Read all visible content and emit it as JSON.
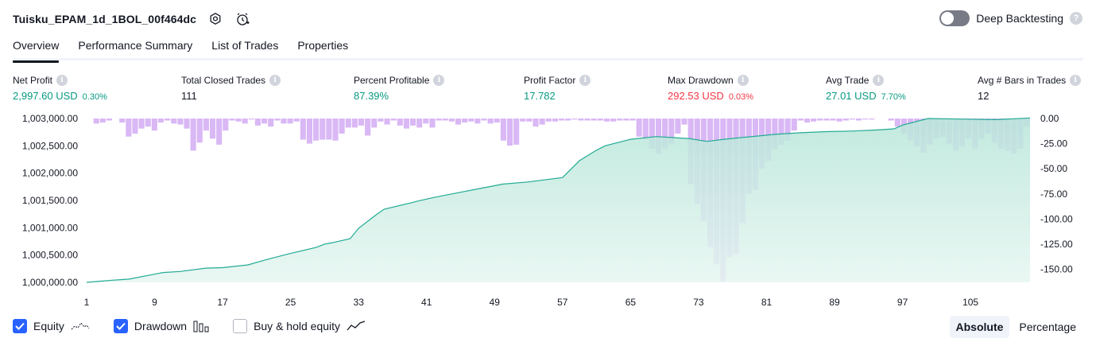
{
  "header": {
    "strategy_title": "Tuisku_EPAM_1d_1BOL_00f464dc",
    "deep_backtesting_label": "Deep Backtesting",
    "deep_backtesting_enabled": false
  },
  "tabs": [
    {
      "label": "Overview",
      "active": true
    },
    {
      "label": "Performance Summary",
      "active": false
    },
    {
      "label": "List of Trades",
      "active": false
    },
    {
      "label": "Properties",
      "active": false
    }
  ],
  "metrics": {
    "net_profit": {
      "label": "Net Profit",
      "value": "2,997.60 USD",
      "pct": "0.30%"
    },
    "total_closed_trades": {
      "label": "Total Closed Trades",
      "value": "111"
    },
    "percent_profitable": {
      "label": "Percent Profitable",
      "value": "87.39%"
    },
    "profit_factor": {
      "label": "Profit Factor",
      "value": "17.782"
    },
    "max_drawdown": {
      "label": "Max Drawdown",
      "value": "292.53 USD",
      "pct": "0.03%"
    },
    "avg_trade": {
      "label": "Avg Trade",
      "value": "27.01 USD",
      "pct": "7.70%"
    },
    "avg_bars": {
      "label": "Avg # Bars in Trades",
      "value": "12"
    }
  },
  "legend": {
    "equity_label": "Equity",
    "drawdown_label": "Drawdown",
    "buyhold_label": "Buy & hold equity",
    "equity_checked": true,
    "drawdown_checked": true,
    "buyhold_checked": false
  },
  "modes": {
    "absolute_label": "Absolute",
    "percentage_label": "Percentage",
    "active": "Absolute"
  },
  "colors": {
    "accent": "#2962ff",
    "equity_line": "#22ab94",
    "equity_fill": "#c7ebe2",
    "drawdown_bar": "#d9b8f5",
    "profit": "#089981",
    "loss": "#f23645"
  },
  "chart_data": {
    "type": "area",
    "left_axis": {
      "ticks": [
        "1,003,000.00",
        "1,002,500.00",
        "1,002,000.00",
        "1,001,500.00",
        "1,001,000.00",
        "1,000,500.00",
        "1,000,000.00"
      ],
      "range": [
        1000000,
        1003000
      ]
    },
    "right_axis": {
      "ticks": [
        "0.00",
        "-25.00",
        "-50.00",
        "-75.00",
        "-100.00",
        "-125.00",
        "-150.00"
      ],
      "range": [
        -163,
        0
      ]
    },
    "x_ticks": [
      "1",
      "9",
      "17",
      "25",
      "33",
      "41",
      "49",
      "57",
      "65",
      "73",
      "81",
      "89",
      "97",
      "105"
    ],
    "x_range": [
      1,
      112
    ],
    "series": [
      {
        "name": "Equity",
        "kind": "area-line",
        "points": [
          [
            1,
            1000000
          ],
          [
            4,
            1000040
          ],
          [
            5,
            1000050
          ],
          [
            6,
            1000060
          ],
          [
            9,
            1000150
          ],
          [
            10,
            1000180
          ],
          [
            12,
            1000200
          ],
          [
            15,
            1000260
          ],
          [
            17,
            1000270
          ],
          [
            20,
            1000320
          ],
          [
            22,
            1000410
          ],
          [
            25,
            1000530
          ],
          [
            28,
            1000640
          ],
          [
            29,
            1000700
          ],
          [
            30,
            1000730
          ],
          [
            32,
            1000800
          ],
          [
            33,
            1000990
          ],
          [
            35,
            1001230
          ],
          [
            36,
            1001340
          ],
          [
            39,
            1001450
          ],
          [
            40,
            1001490
          ],
          [
            42,
            1001560
          ],
          [
            45,
            1001650
          ],
          [
            48,
            1001740
          ],
          [
            50,
            1001800
          ],
          [
            53,
            1001840
          ],
          [
            57,
            1001920
          ],
          [
            59,
            1002230
          ],
          [
            61,
            1002420
          ],
          [
            62,
            1002500
          ],
          [
            63,
            1002540
          ],
          [
            65,
            1002620
          ],
          [
            68,
            1002670
          ],
          [
            70,
            1002650
          ],
          [
            72,
            1002630
          ],
          [
            74,
            1002580
          ],
          [
            76,
            1002620
          ],
          [
            78,
            1002650
          ],
          [
            80,
            1002680
          ],
          [
            82,
            1002710
          ],
          [
            85,
            1002740
          ],
          [
            88,
            1002760
          ],
          [
            91,
            1002770
          ],
          [
            94,
            1002790
          ],
          [
            96,
            1002810
          ],
          [
            97,
            1002880
          ],
          [
            98,
            1002920
          ],
          [
            99,
            1002960
          ],
          [
            100,
            1003000
          ],
          [
            104,
            1002990
          ],
          [
            108,
            1002980
          ],
          [
            112,
            1003010
          ]
        ]
      },
      {
        "name": "Drawdown",
        "kind": "bar",
        "values": [
          0,
          -5,
          -4,
          -2,
          0,
          -4,
          -18,
          -15,
          -10,
          -8,
          -12,
          -4,
          -2,
          -5,
          -6,
          -10,
          -32,
          -24,
          -12,
          -20,
          -26,
          -12,
          -2,
          -3,
          -5,
          -1,
          -7,
          -5,
          -8,
          -2,
          -5,
          -5,
          -3,
          -21,
          -25,
          -22,
          -21,
          -21,
          -22,
          -15,
          -9,
          -9,
          -7,
          -17,
          -9,
          -3,
          -6,
          -2,
          -7,
          -10,
          -7,
          -9,
          -5,
          -9,
          -2,
          -2,
          -3,
          -6,
          -4,
          -3,
          -5,
          -2,
          -5,
          -4,
          -22,
          -27,
          -26,
          -3,
          -3,
          -8,
          -6,
          -3,
          -3,
          -2,
          -2,
          -1,
          -2,
          -2,
          -2,
          -2,
          -3,
          -3,
          -2,
          -2,
          -2,
          -18,
          -21,
          -30,
          -35,
          -30,
          -25,
          -15,
          -6,
          -65,
          -85,
          -102,
          -128,
          -145,
          -162,
          -138,
          -135,
          -104,
          -75,
          -71,
          -50,
          -42,
          -30,
          -26,
          -22,
          -12,
          -2,
          -4,
          -3,
          -2,
          -2,
          -2,
          -3,
          -2,
          -1,
          -2,
          -1,
          -1,
          0,
          0,
          -2,
          -8,
          -15,
          -22,
          -28,
          -34,
          -26,
          -20,
          -18,
          -25,
          -32,
          -28,
          -20,
          -30,
          -20,
          -15,
          -24,
          -30,
          -32,
          -35,
          -30,
          -8
        ]
      }
    ]
  }
}
